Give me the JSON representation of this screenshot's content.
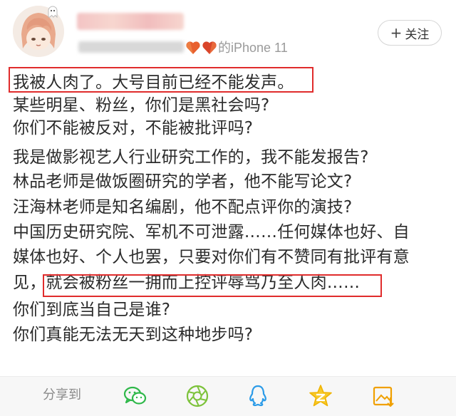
{
  "post": {
    "device": "的iPhone 11",
    "follow_label": "关注",
    "follow_plus": "+",
    "lines": [
      "我被人肉了。大号目前已经不能发声。",
      "某些明星、粉丝，你们是黑社会吗?",
      "你们不能被反对，不能被批评吗?",
      "我是做影视艺人行业研究工作的，我不能发报告?",
      "林品老师是做饭圈研究的学者，他不能写论文?",
      "汪海林老师是知名编剧，他不配点评你的演技?",
      "中国历史研究院、军机不可泄露……任何媒体也好、自",
      "媒体也好、个人也罢，只要对你们有不赞同有批评有意",
      "见，就会被粉丝一拥而上控评辱骂乃至人肉……",
      "你们到底当自己是谁?",
      "你们真能无法无天到这种地步吗?"
    ]
  },
  "share": {
    "label": "分享到",
    "icons": [
      "wechat-icon",
      "moments-icon",
      "qq-icon",
      "qzone-icon",
      "save-image-icon"
    ],
    "accent": "#f0b400"
  },
  "highlight_color": "#e02c2c"
}
